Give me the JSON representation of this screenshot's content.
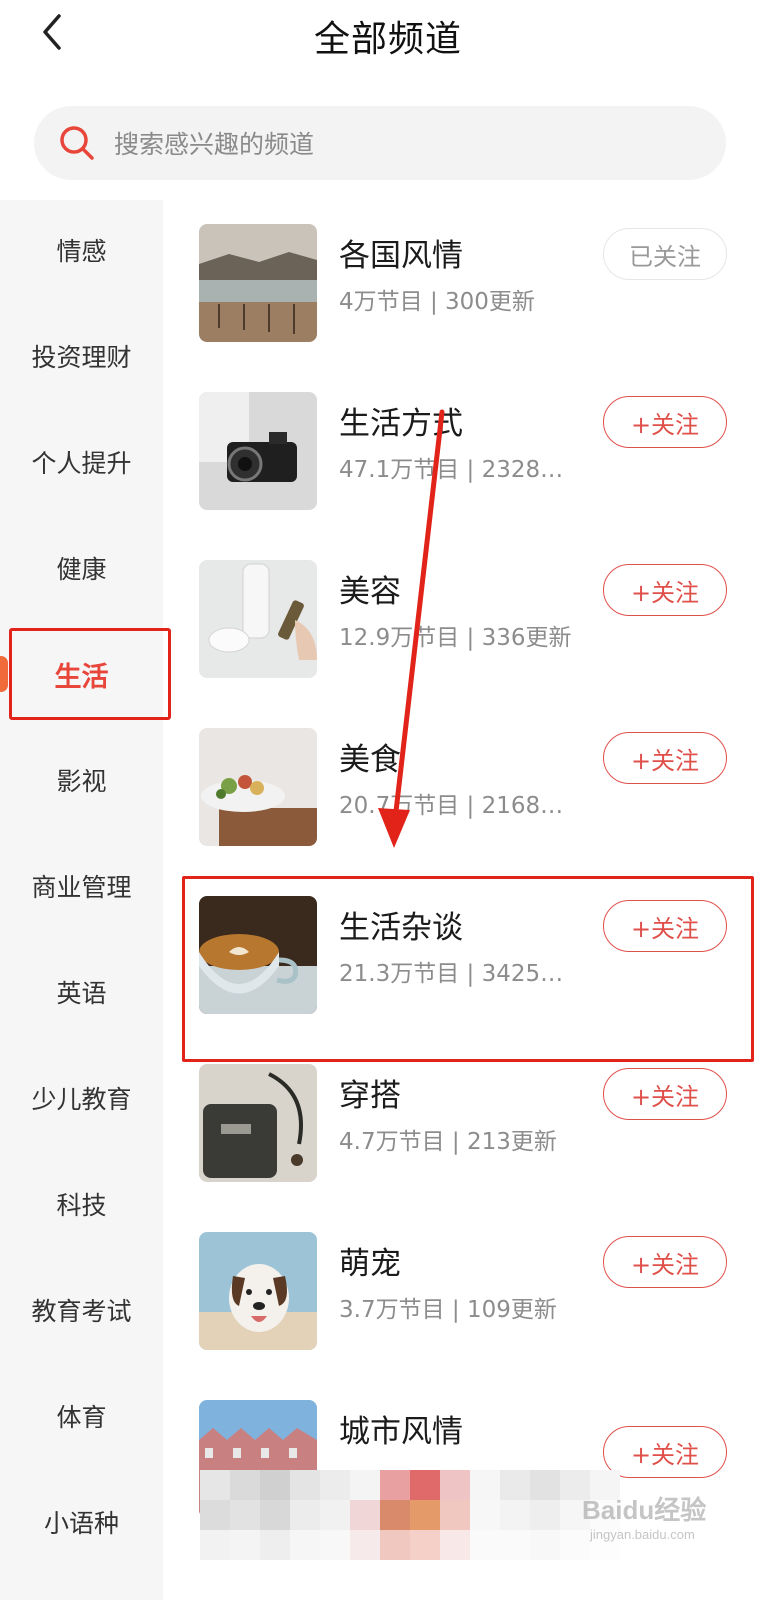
{
  "header": {
    "title": "全部频道",
    "back_icon": "chevron-left-icon"
  },
  "search": {
    "placeholder": "搜索感兴趣的频道",
    "icon": "search-icon",
    "icon_color": "#e8463a"
  },
  "sidebar": {
    "active_color": "#e8463a",
    "items": [
      {
        "label": "情感"
      },
      {
        "label": "投资理财"
      },
      {
        "label": "个人提升"
      },
      {
        "label": "健康"
      },
      {
        "label": "生活",
        "active": true
      },
      {
        "label": "影视"
      },
      {
        "label": "商业管理"
      },
      {
        "label": "英语"
      },
      {
        "label": "少儿教育"
      },
      {
        "label": "科技"
      },
      {
        "label": "教育考试"
      },
      {
        "label": "体育"
      },
      {
        "label": "小语种"
      }
    ]
  },
  "channels": [
    {
      "name": "各国风情",
      "programs": "4万节目",
      "updates": "300更新",
      "button": "已关注",
      "followed": true
    },
    {
      "name": "生活方式",
      "programs": "47.1万节目",
      "updates": "2328…",
      "button": "+关注",
      "followed": false
    },
    {
      "name": "美容",
      "programs": "12.9万节目",
      "updates": "336更新",
      "button": "+关注",
      "followed": false
    },
    {
      "name": "美食",
      "programs": "20.7万节目",
      "updates": "2168…",
      "button": "+关注",
      "followed": false
    },
    {
      "name": "生活杂谈",
      "programs": "21.3万节目",
      "updates": "3425…",
      "button": "+关注",
      "followed": false
    },
    {
      "name": "穿搭",
      "programs": "4.7万节目",
      "updates": "213更新",
      "button": "+关注",
      "followed": false
    },
    {
      "name": "萌宠",
      "programs": "3.7万节目",
      "updates": "109更新",
      "button": "+关注",
      "followed": false
    },
    {
      "name": "城市风情",
      "programs": "",
      "updates": "",
      "button": "+关注",
      "followed": false
    }
  ],
  "meta_separator": "|",
  "annotation_color": "#e2231a",
  "watermark": {
    "main": "Baidu经验",
    "sub": "jingyan.baidu.com"
  }
}
